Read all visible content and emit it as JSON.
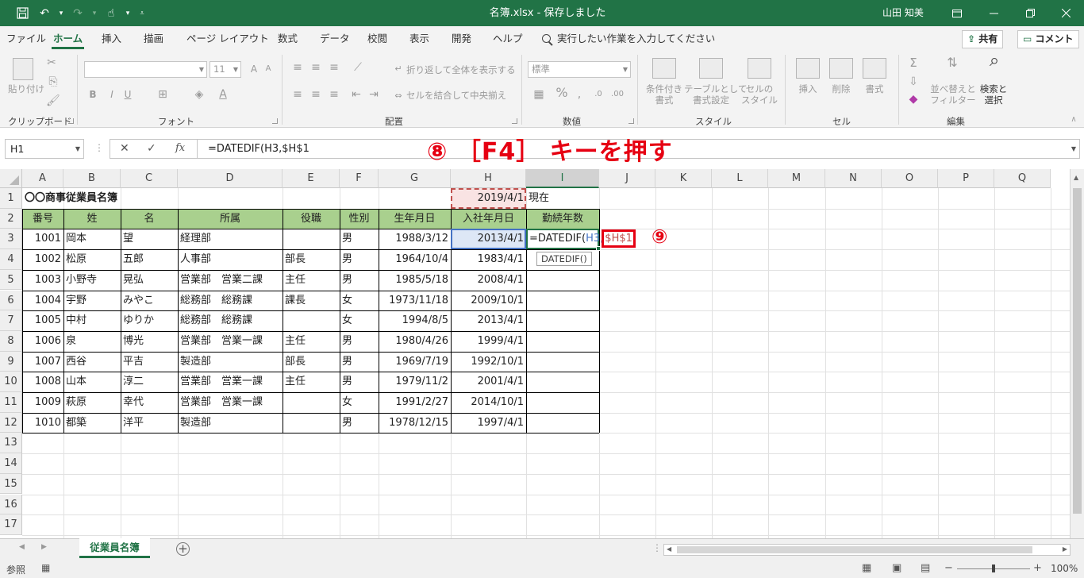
{
  "titlebar": {
    "doc_title": "名簿.xlsx - 保存しました",
    "user_name": "山田 知美",
    "save_icon": "save-icon",
    "undo_icon": "undo-icon",
    "redo_icon": "redo-icon",
    "touch_icon": "touch-mode-icon",
    "ribbon_display_icon": "ribbon-display-options-icon",
    "minimize_icon": "minimize-icon",
    "restore_icon": "restore-icon",
    "close_icon": "close-icon"
  },
  "ribbon_tabs": [
    "ファイル",
    "ホーム",
    "挿入",
    "描画",
    "ページ レイアウト",
    "数式",
    "データ",
    "校閲",
    "表示",
    "開発",
    "ヘルプ"
  ],
  "tell_me": "実行したい作業を入力してください",
  "share_label": "共有",
  "comment_label": "コメント",
  "ribbon": {
    "clipboard": {
      "label": "クリップボード",
      "paste": "貼り付け"
    },
    "font": {
      "label": "フォント",
      "font_name": "",
      "font_size": "11",
      "bold": "B",
      "italic": "I",
      "underline": "U"
    },
    "alignment": {
      "label": "配置",
      "wrap_text": "折り返して全体を表示する",
      "merge_center": "セルを結合して中央揃え"
    },
    "number": {
      "label": "数値",
      "format": "標準",
      "percent": "%"
    },
    "styles": {
      "label": "スタイル",
      "conditional": "条件付き\n書式",
      "as_table": "テーブルとして\n書式設定",
      "cell_styles": "セルの\nスタイル"
    },
    "cells": {
      "label": "セル",
      "insert": "挿入",
      "delete": "削除",
      "format": "書式"
    },
    "editing": {
      "label": "編集",
      "sort_filter": "並べ替えと\nフィルター",
      "find_select": "検索と\n選択"
    }
  },
  "formula_bar": {
    "name_box": "H1",
    "formula": "=DATEDIF(H3,$H$1",
    "cancel_icon": "cancel-icon",
    "enter_icon": "check-icon",
    "fx_label": "fx"
  },
  "annotations": {
    "step8": "⑧ ［F4］ キーを押す",
    "step9": "⑨"
  },
  "columns": [
    "A",
    "B",
    "C",
    "D",
    "E",
    "F",
    "G",
    "H",
    "I",
    "J",
    "K",
    "L",
    "M",
    "N",
    "O",
    "P",
    "Q"
  ],
  "rows": [
    "1",
    "2",
    "3",
    "4",
    "5",
    "6",
    "7",
    "8",
    "9",
    "10",
    "11",
    "12",
    "13",
    "14",
    "15",
    "16",
    "17"
  ],
  "sheet": {
    "title": "〇〇商事従業員名簿",
    "base_date": "2019/4/1",
    "base_date_suffix": "現在",
    "headers": [
      "番号",
      "姓",
      "名",
      "所属",
      "役職",
      "性別",
      "生年月日",
      "入社年月日",
      "勤続年数"
    ],
    "employees": [
      [
        "1001",
        "岡本",
        "望",
        "経理部",
        "",
        "男",
        "1988/3/12",
        "2013/4/1",
        ""
      ],
      [
        "1002",
        "松原",
        "五郎",
        "人事部",
        "部長",
        "男",
        "1964/10/4",
        "1983/4/1",
        ""
      ],
      [
        "1003",
        "小野寺",
        "晃弘",
        "営業部　営業二課",
        "主任",
        "男",
        "1985/5/18",
        "2008/4/1",
        ""
      ],
      [
        "1004",
        "宇野",
        "みやこ",
        "総務部　総務課",
        "課長",
        "女",
        "1973/11/18",
        "2009/10/1",
        ""
      ],
      [
        "1005",
        "中村",
        "ゆりか",
        "総務部　総務課",
        "",
        "女",
        "1994/8/5",
        "2013/4/1",
        ""
      ],
      [
        "1006",
        "泉",
        "博光",
        "営業部　営業一課",
        "主任",
        "男",
        "1980/4/26",
        "1999/4/1",
        ""
      ],
      [
        "1007",
        "西谷",
        "平吉",
        "製造部",
        "部長",
        "男",
        "1969/7/19",
        "1992/10/1",
        ""
      ],
      [
        "1008",
        "山本",
        "淳二",
        "営業部　営業一課",
        "主任",
        "男",
        "1979/11/2",
        "2001/4/1",
        ""
      ],
      [
        "1009",
        "萩原",
        "幸代",
        "営業部　営業一課",
        "",
        "女",
        "1991/2/27",
        "2014/10/1",
        ""
      ],
      [
        "1010",
        "都築",
        "洋平",
        "製造部",
        "",
        "男",
        "1978/12/15",
        "1997/4/1",
        ""
      ]
    ],
    "editing_cell": {
      "prefix": "=DATEDIF(",
      "ref1": "H3",
      "sep": ",",
      "ref2": "$H$1"
    },
    "tooltip": "DATEDIF()"
  },
  "sheet_tabs": [
    "従業員名簿"
  ],
  "status": {
    "mode": "参照",
    "zoom": "100%"
  },
  "colors": {
    "excel_green": "#217346",
    "header_green": "#a9d08e",
    "annotation_red": "#e60012",
    "ref_blue": "#4472c4",
    "ref_red": "#c0504d"
  }
}
